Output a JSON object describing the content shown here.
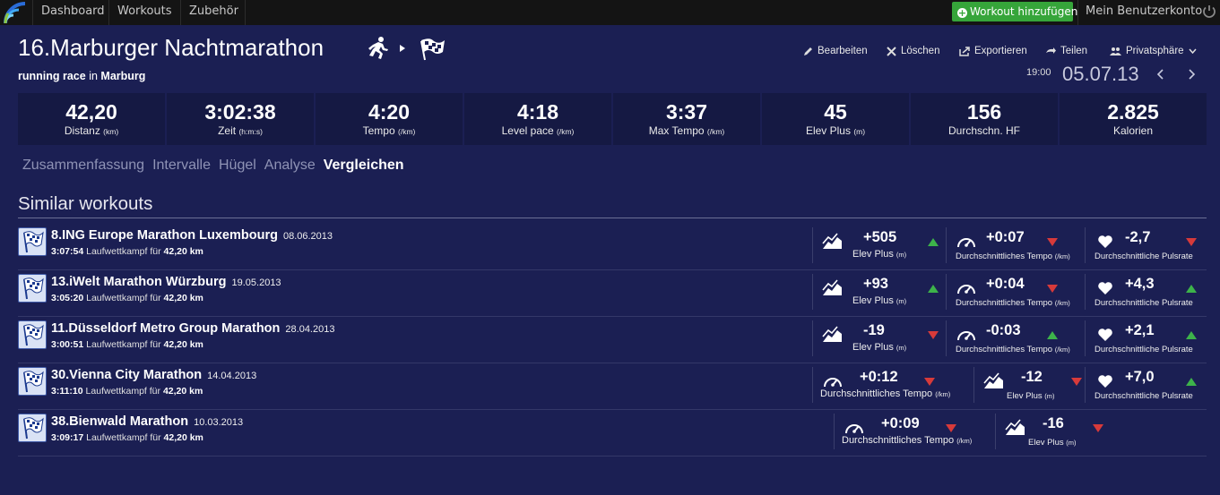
{
  "nav": {
    "items": [
      "Dashboard",
      "Workouts",
      "Zubehör"
    ],
    "add_workout": "Workout hinzufügen",
    "account": "Mein Benutzerkonto"
  },
  "workout": {
    "title": "16.Marburger Nachtmarathon",
    "sport": "running race",
    "in_word": "in",
    "location": "Marburg",
    "time": "19:00",
    "date": "05.07.13"
  },
  "actions": {
    "edit": "Bearbeiten",
    "delete": "Löschen",
    "export": "Exportieren",
    "share": "Teilen",
    "privacy": "Privatsphäre"
  },
  "stats": [
    {
      "value": "42,20",
      "label": "Distanz",
      "unit": "(km)"
    },
    {
      "value": "3:02:38",
      "label": "Zeit",
      "unit": "(h:m:s)"
    },
    {
      "value": "4:20",
      "label": "Tempo",
      "unit": "(/km)"
    },
    {
      "value": "4:18",
      "label": "Level pace",
      "unit": "(/km)"
    },
    {
      "value": "3:37",
      "label": "Max Tempo",
      "unit": "(/km)"
    },
    {
      "value": "45",
      "label": "Elev Plus",
      "unit": "(m)"
    },
    {
      "value": "156",
      "label": "Durchschn. HF",
      "unit": ""
    },
    {
      "value": "2.825",
      "label": "Kalorien",
      "unit": ""
    }
  ],
  "tabs": [
    "Zusammenfassung",
    "Intervalle",
    "Hügel",
    "Analyse",
    "Vergleichen"
  ],
  "section_title": "Similar workouts",
  "sub_text": "Laufwettkampf für",
  "rows": [
    {
      "name": "8.ING Europe Marathon Luxembourg",
      "date": "08.06.2013",
      "duration": "3:07:54",
      "distance": "42,20 km",
      "metrics": [
        {
          "icon": "elevation-icon",
          "value": "+505",
          "label": "Elev Plus",
          "unit": "(m)",
          "trend": "up"
        },
        {
          "icon": "speedometer-icon",
          "value": "+0:07",
          "label": "Durchschnittliches Tempo",
          "unit": "(/km)",
          "trend": "down"
        },
        {
          "icon": "heart-icon",
          "value": "-2,7",
          "label": "Durchschnittliche Pulsrate",
          "unit": "",
          "trend": "down"
        }
      ]
    },
    {
      "name": "13.iWelt Marathon Würzburg",
      "date": "19.05.2013",
      "duration": "3:05:20",
      "distance": "42,20 km",
      "metrics": [
        {
          "icon": "elevation-icon",
          "value": "+93",
          "label": "Elev Plus",
          "unit": "(m)",
          "trend": "up"
        },
        {
          "icon": "speedometer-icon",
          "value": "+0:04",
          "label": "Durchschnittliches Tempo",
          "unit": "(/km)",
          "trend": "down"
        },
        {
          "icon": "heart-icon",
          "value": "+4,3",
          "label": "Durchschnittliche Pulsrate",
          "unit": "",
          "trend": "up"
        }
      ]
    },
    {
      "name": "11.Düsseldorf Metro Group Marathon",
      "date": "28.04.2013",
      "duration": "3:00:51",
      "distance": "42,20 km",
      "metrics": [
        {
          "icon": "elevation-icon",
          "value": "-19",
          "label": "Elev Plus",
          "unit": "(m)",
          "trend": "down"
        },
        {
          "icon": "speedometer-icon",
          "value": "-0:03",
          "label": "Durchschnittliches Tempo",
          "unit": "(/km)",
          "trend": "up"
        },
        {
          "icon": "heart-icon",
          "value": "+2,1",
          "label": "Durchschnittliche Pulsrate",
          "unit": "",
          "trend": "up"
        }
      ]
    },
    {
      "name": "30.Vienna City Marathon",
      "date": "14.04.2013",
      "duration": "3:11:10",
      "distance": "42,20 km",
      "metrics": [
        {
          "icon": "speedometer-icon",
          "value": "+0:12",
          "label": "Durchschnittliches Tempo",
          "unit": "(/km)",
          "trend": "down"
        },
        {
          "icon": "elevation-icon",
          "value": "-12",
          "label": "Elev Plus",
          "unit": "(m)",
          "trend": "down"
        },
        {
          "icon": "heart-icon",
          "value": "+7,0",
          "label": "Durchschnittliche Pulsrate",
          "unit": "",
          "trend": "up"
        }
      ]
    },
    {
      "name": "38.Bienwald Marathon",
      "date": "10.03.2013",
      "duration": "3:09:17",
      "distance": "42,20 km",
      "metrics": [
        {
          "icon": "speedometer-icon",
          "value": "+0:09",
          "label": "Durchschnittliches Tempo",
          "unit": "(/km)",
          "trend": "down"
        },
        {
          "icon": "elevation-icon",
          "value": "-16",
          "label": "Elev Plus",
          "unit": "(m)",
          "trend": "down"
        }
      ]
    }
  ],
  "colors": {
    "background": "#1b1f53",
    "tile": "#151943",
    "add_button": "#36a53a",
    "up": "#3db34a",
    "down": "#d73a3a"
  }
}
